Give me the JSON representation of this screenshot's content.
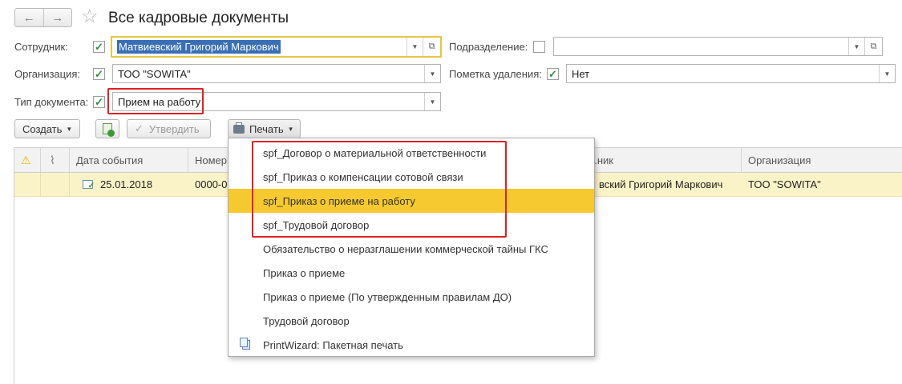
{
  "window": {
    "title": "Все кадровые документы"
  },
  "nav": {
    "back": "←",
    "forward": "→"
  },
  "filters": {
    "employee_label": "Сотрудник:",
    "employee_value": "Матвиевский Григорий Маркович",
    "department_label": "Подразделение:",
    "department_value": "",
    "organization_label": "Организация:",
    "organization_value": "ТОО \"SOWITA\"",
    "deletion_mark_label": "Пометка удаления:",
    "deletion_mark_value": "Нет",
    "doc_type_label": "Тип документа:",
    "doc_type_value": "Прием на работу"
  },
  "toolbar": {
    "create_label": "Создать",
    "approve_label": "Утвердить",
    "print_label": "Печать"
  },
  "table": {
    "columns": [
      "Дата события",
      "Номер",
      "...ник",
      "Организация"
    ],
    "rows": [
      {
        "date": "25.01.2018",
        "number": "0000-0",
        "employee": "вский Григорий Маркович",
        "organization": "ТОО \"SOWITA\""
      }
    ]
  },
  "print_menu": {
    "items": [
      "spf_Договор о материальной ответственности",
      "spf_Приказ о компенсации сотовой связи",
      "spf_Приказ о приеме на работу",
      "spf_Трудовой договор",
      "Обязательство о неразглашении коммерческой тайны ГКС",
      "Приказ о приеме",
      "Приказ о приеме (По утвержденным правилам ДО)",
      "Трудовой договор",
      "PrintWizard: Пакетная печать"
    ],
    "highlighted_index": 2
  },
  "colors": {
    "highlight": "#f5c92f",
    "row_selected": "#fbf3c8",
    "annotation_red": "#e02020",
    "check_green": "#2e8b3a"
  }
}
